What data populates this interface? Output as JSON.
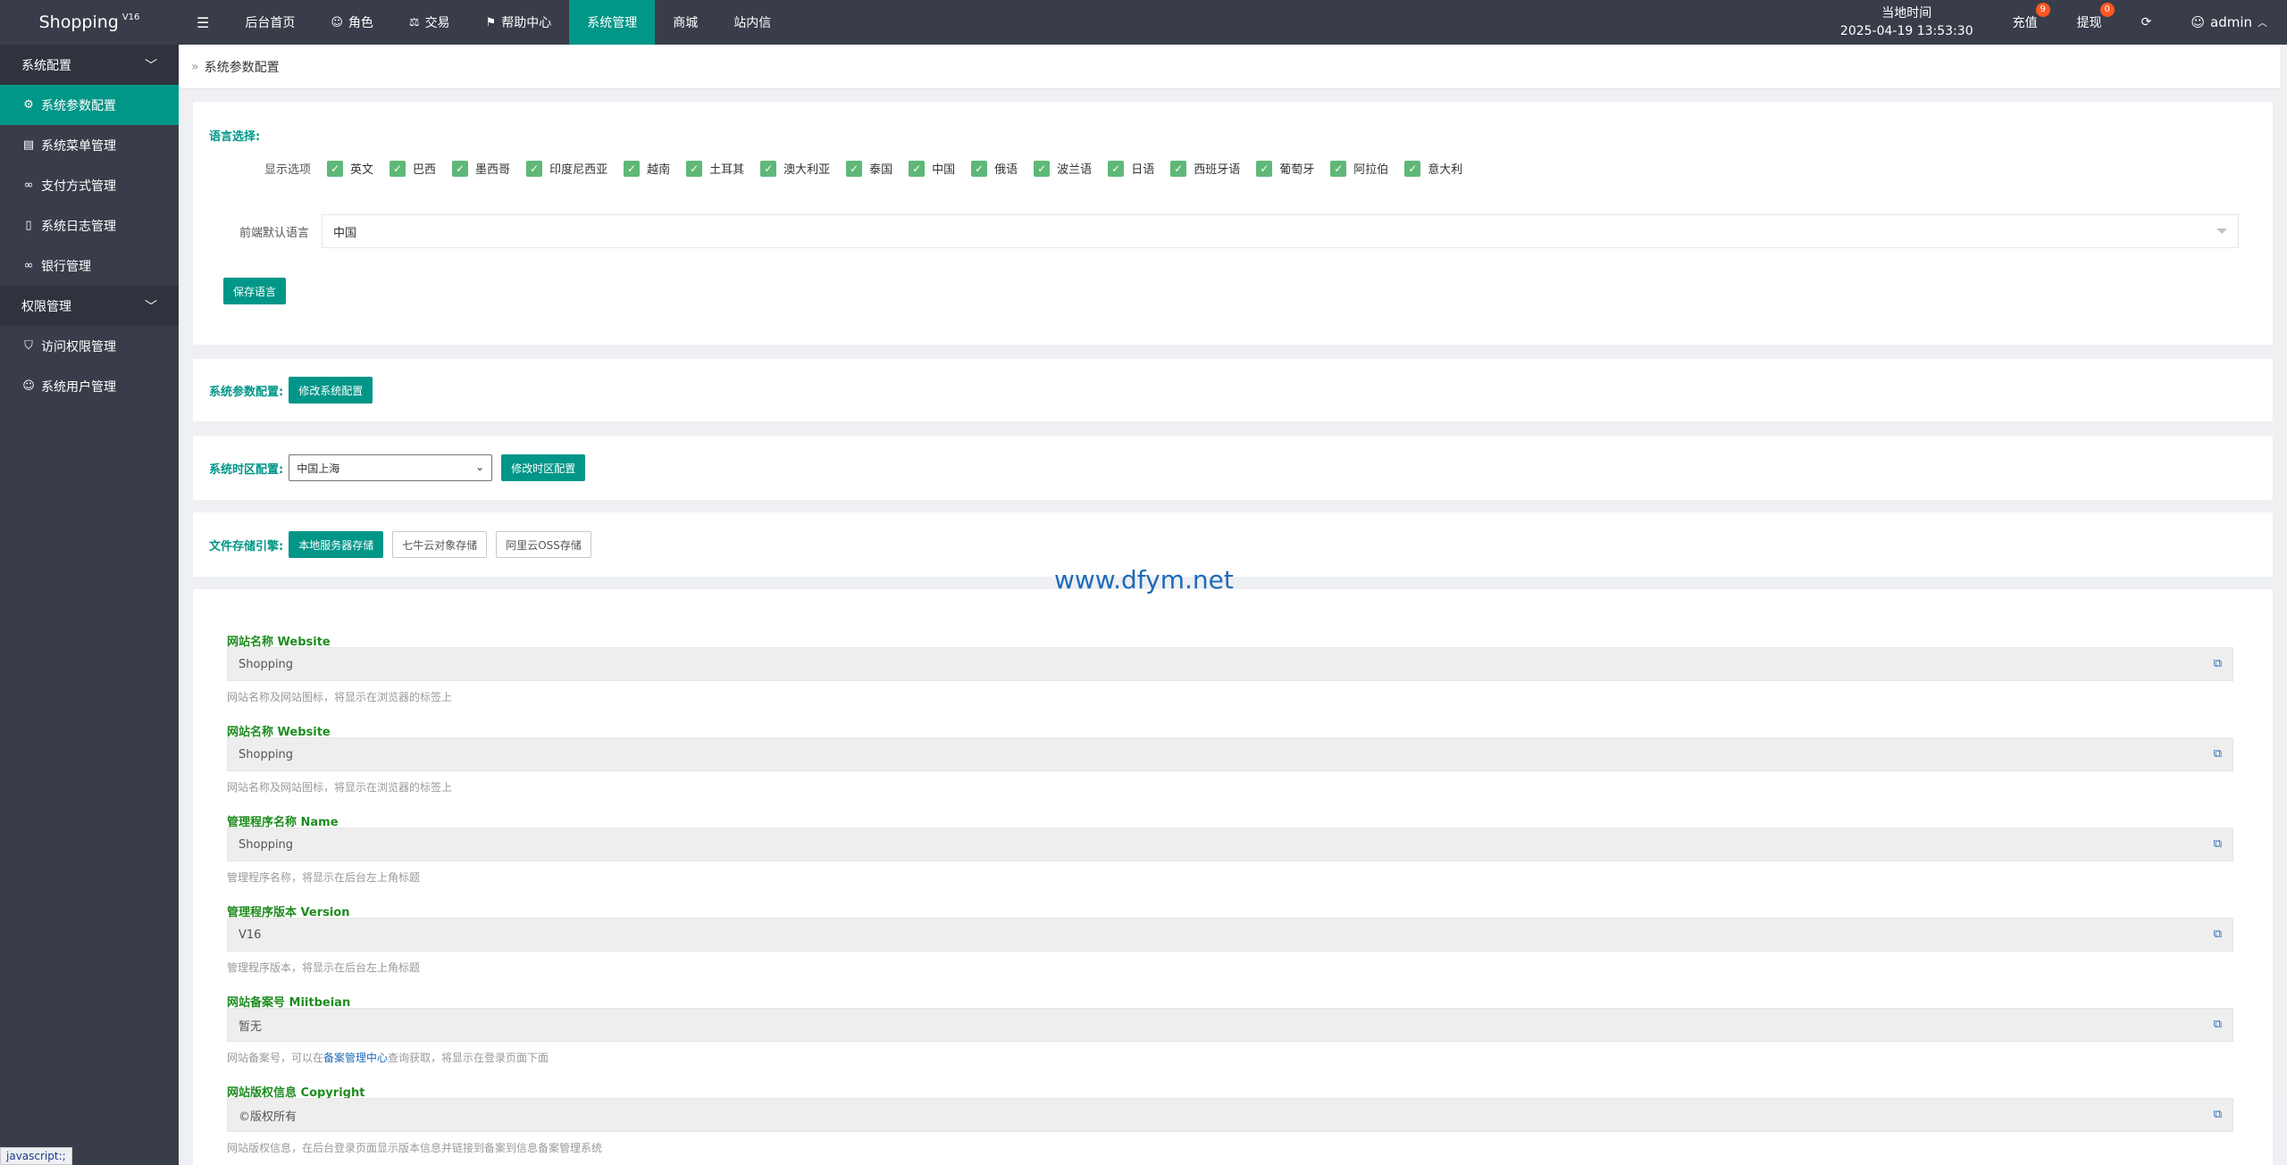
{
  "brand": {
    "name": "Shopping",
    "version": "V16"
  },
  "topnav": {
    "menu_icon": "hamburger-icon",
    "items": [
      {
        "label": "后台首页",
        "icon": ""
      },
      {
        "label": "角色",
        "icon": "user-icon"
      },
      {
        "label": "交易",
        "icon": "scale-icon"
      },
      {
        "label": "帮助中心",
        "icon": "flag-icon"
      },
      {
        "label": "系统管理",
        "icon": "",
        "active": true
      },
      {
        "label": "商城",
        "icon": ""
      },
      {
        "label": "站内信",
        "icon": ""
      }
    ]
  },
  "clock": {
    "label": "当地时间",
    "value": "2025-04-19 13:53:30"
  },
  "topright": {
    "recharge": {
      "label": "充值",
      "badge": "9"
    },
    "withdraw": {
      "label": "提现",
      "badge": "0"
    },
    "refresh_icon": "refresh-icon",
    "user": "admin"
  },
  "sidebar": {
    "group1": "系统配置",
    "items1": [
      {
        "label": "系统参数配置",
        "icon": "gear-icon",
        "active": true
      },
      {
        "label": "系统菜单管理",
        "icon": "table-icon"
      },
      {
        "label": "支付方式管理",
        "icon": "link-icon"
      },
      {
        "label": "系统日志管理",
        "icon": "doc-icon"
      },
      {
        "label": "银行管理",
        "icon": "link-icon"
      }
    ],
    "group2": "权限管理",
    "items2": [
      {
        "label": "访问权限管理",
        "icon": "shield-icon"
      },
      {
        "label": "系统用户管理",
        "icon": "user-icon"
      }
    ]
  },
  "breadcrumb": "系统参数配置",
  "language": {
    "section_label": "语言选择:",
    "display_label": "显示选项",
    "options": [
      "英文",
      "巴西",
      "墨西哥",
      "印度尼西亚",
      "越南",
      "土耳其",
      "澳大利亚",
      "泰国",
      "中国",
      "俄语",
      "波兰语",
      "日语",
      "西班牙语",
      "葡萄牙",
      "阿拉伯",
      "意大利"
    ],
    "default_label": "前端默认语言",
    "default_value": "中国",
    "save_button": "保存语言"
  },
  "sysparams": {
    "label": "系统参数配置:",
    "button": "修改系统配置"
  },
  "timezone": {
    "label": "系统时区配置:",
    "value": "中国上海",
    "button": "修改时区配置"
  },
  "storage": {
    "label": "文件存储引擎:",
    "options": [
      "本地服务器存储",
      "七牛云对象存储",
      "阿里云OSS存储"
    ]
  },
  "fields": [
    {
      "label": "网站名称 Website",
      "value": "Shopping",
      "help": "网站名称及网站图标，将显示在浏览器的标签上"
    },
    {
      "label": "网站名称 Website",
      "value": "Shopping",
      "help": "网站名称及网站图标，将显示在浏览器的标签上"
    },
    {
      "label": "管理程序名称 Name",
      "value": "Shopping",
      "help": "管理程序名称，将显示在后台左上角标题"
    },
    {
      "label": "管理程序版本 Version",
      "value": "V16",
      "help": "管理程序版本，将显示在后台左上角标题"
    },
    {
      "label": "网站备案号 Miitbeian",
      "value": "暂无",
      "help_pre": "网站备案号，可以在",
      "help_link": "备案管理中心",
      "help_post": "查询获取，将显示在登录页面下面"
    },
    {
      "label": "网站版权信息 Copyright",
      "value": "©版权所有",
      "help": "网站版权信息，在后台登录页面显示版本信息并链接到备案到信息备案管理系统"
    }
  ],
  "watermark": "www.dfym.net",
  "statusbar": "javascript:;"
}
